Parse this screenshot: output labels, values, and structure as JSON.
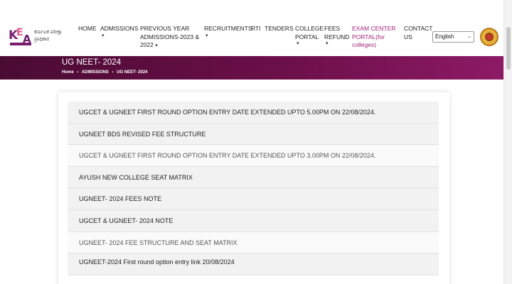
{
  "header": {
    "logo": {
      "letters": "KEA",
      "text_line1": "ಕರ್ನಾಟಕ ಪರೀಕ್ಷಾ",
      "text_line2": "ಪ್ರಾಧಿಕಾರ"
    },
    "nav": [
      {
        "label": "HOME",
        "has_dropdown": false
      },
      {
        "label": "ADMISSIONS",
        "has_dropdown": true
      },
      {
        "label_lines": [
          "PREVIOUS YEAR",
          "ADMISSIONS-2023 &",
          "2022"
        ],
        "has_dropdown": true
      },
      {
        "label": "RECRUITMENTS",
        "has_dropdown": true
      },
      {
        "label": "RTI",
        "has_dropdown": false
      },
      {
        "label": "TENDERS",
        "has_dropdown": false
      },
      {
        "label_lines": [
          "COLLEGE",
          "PORTAL"
        ],
        "has_dropdown": true
      },
      {
        "label_lines": [
          "FEES",
          "REFUND"
        ],
        "has_dropdown": true
      },
      {
        "label_lines": [
          "EXAM CENTER",
          "PORTAL(for",
          "colleges)"
        ],
        "has_dropdown": false,
        "accent": "#a0207a"
      },
      {
        "label_lines": [
          "CONTACT",
          "US"
        ],
        "has_dropdown": false
      }
    ],
    "language": {
      "selected": "English"
    },
    "emblem": {
      "icon": "state-emblem-icon"
    }
  },
  "banner": {
    "title": "UG NEET- 2024",
    "breadcrumb": [
      "Home",
      "ADMISSIONS",
      "UG NEET- 2024"
    ],
    "gradient": [
      "#4a0b33",
      "#8d1a66"
    ]
  },
  "notices": [
    "UGCET & UGNEET FIRST ROUND OPTION ENTRY DATE EXTENDED UPTO 5.00PM ON 22/08/2024.",
    "UGNEET BDS REVISED FEE STRUCTURE",
    "UGCET & UGNEET FIRST ROUND OPTION ENTRY DATE EXTENDED UPTO 3.00PM ON 22/08/2024.",
    "AYUSH NEW COLLEGE SEAT MATRIX",
    "UGNEET- 2024 FEES NOTE",
    "UGCET & UGNEET- 2024 NOTE",
    "UGNEET- 2024 FEE STRUCTURE AND SEAT MATRIX",
    "UGNEET-2024 First round option entry link  20/08/2024"
  ]
}
